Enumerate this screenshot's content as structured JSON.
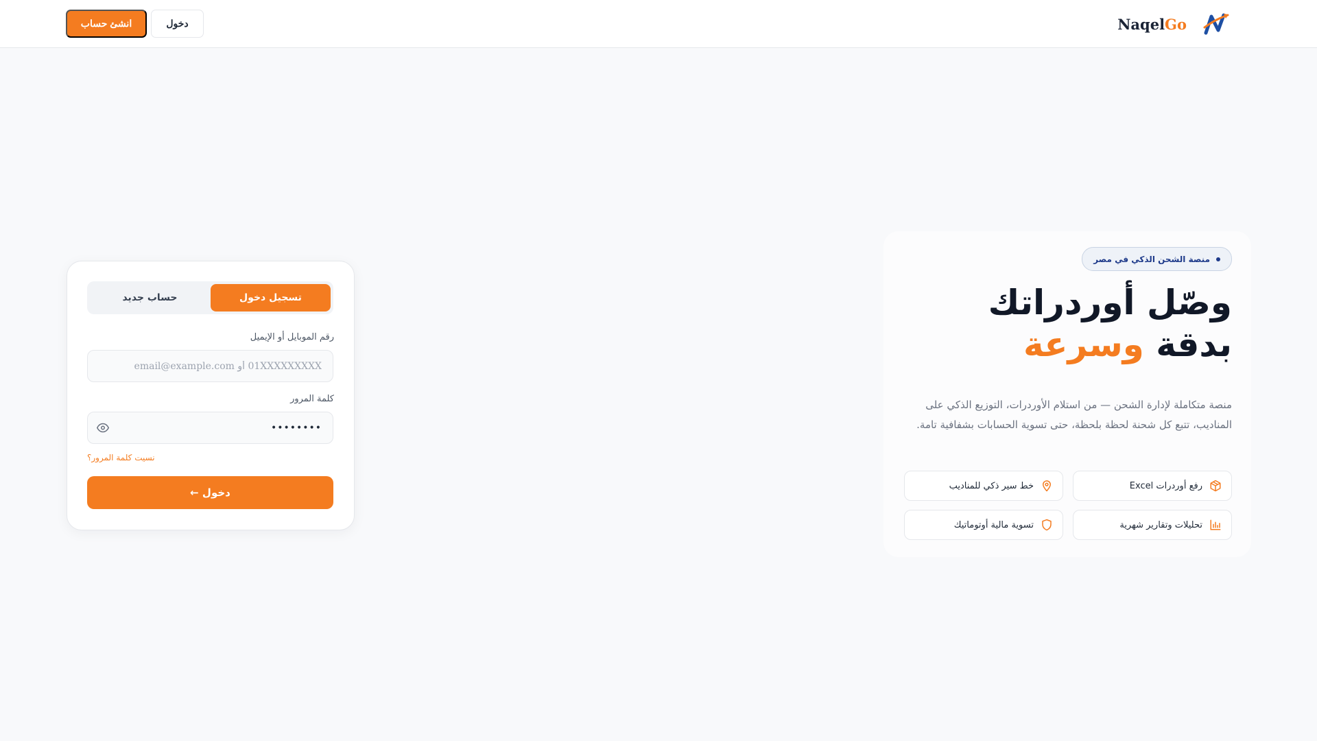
{
  "header": {
    "brand_primary": "Naqel",
    "brand_accent": "Go",
    "login_label": "دخول",
    "signup_label": "انشئ حساب"
  },
  "hero": {
    "badge": "منصة الشحن الذكي في مصر",
    "headline_line1": "وصّل أوردراتك",
    "headline_plain": "بدقة ",
    "headline_accent": "وسرعة",
    "description": "منصة متكاملة لإدارة الشحن — من استلام الأوردرات، التوزيع الذكي على المناديب، تتبع كل شحنة لحظة بلحظة، حتى تسوية الحسابات بشفافية تامة.",
    "features": [
      {
        "label": "رفع أوردرات Excel",
        "icon": "package-icon"
      },
      {
        "label": "خط سير ذكي للمناديب",
        "icon": "map-pin-icon"
      },
      {
        "label": "تحليلات وتقارير شهرية",
        "icon": "bar-chart-icon"
      },
      {
        "label": "تسوية مالية أوتوماتيك",
        "icon": "shield-icon"
      }
    ]
  },
  "login_card": {
    "tab_login": "تسجيل دخول",
    "tab_signup": "حساب جديد",
    "identifier_label": "رقم الموبايل أو الإيميل",
    "identifier_placeholder": "01XXXXXXXXX أو email@example.com",
    "password_label": "كلمة المرور",
    "password_value": "••••••••",
    "forgot_label": "نسيت كلمة المرور؟",
    "submit_label": "دخول ←"
  },
  "colors": {
    "accent": "#f47c20",
    "navy": "#1e3a8a",
    "text": "#111827"
  }
}
